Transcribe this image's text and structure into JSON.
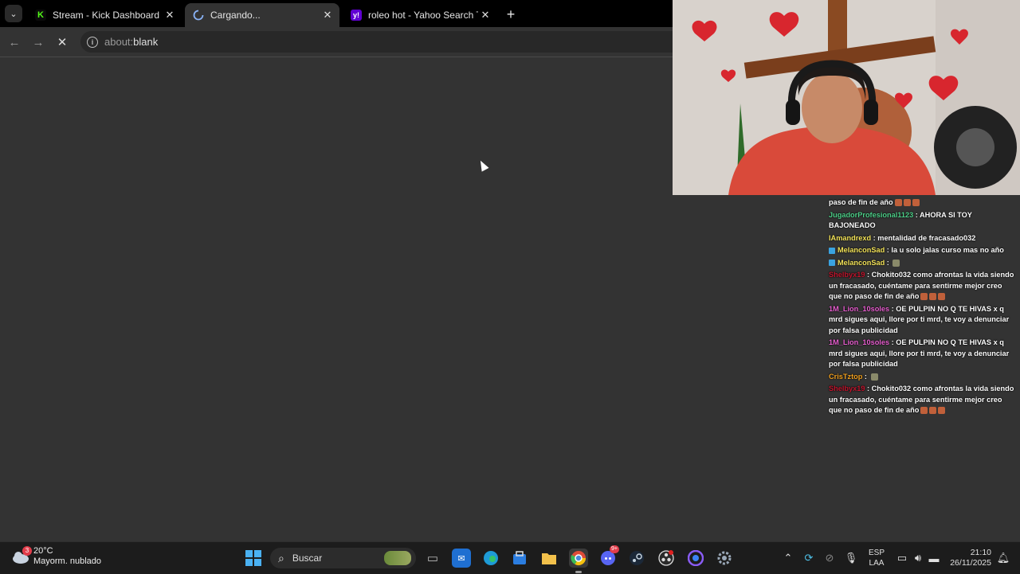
{
  "browser": {
    "tabs": [
      {
        "title": "Stream - Kick Dashboard",
        "favicon": "kick-logo-icon",
        "active": false
      },
      {
        "title": "Cargando...",
        "favicon": "loading-spinner-icon",
        "active": true
      },
      {
        "title": "roleo hot - Yahoo Search Tus re",
        "favicon": "yahoo-logo-icon",
        "active": false
      }
    ],
    "new_tab_symbol": "+",
    "address": {
      "scheme": "about:",
      "path": "blank"
    },
    "colors": {
      "kick": "#53fc18",
      "yahoo": "#6001d2"
    }
  },
  "chat": {
    "messages": [
      {
        "user": "",
        "user_color": "#ffffff",
        "text": "paso de fin de año",
        "emotes": 3
      },
      {
        "user": "JugadorProfesional1123",
        "user_color": "#4fd08a",
        "text": "AHORA SI TOY BAJONEADO",
        "emotes": 0
      },
      {
        "user": "IAmandrexd",
        "user_color": "#f3e35a",
        "text": "mentalidad de fracasado032",
        "emotes": 0
      },
      {
        "user": "MelanconSad",
        "user_color": "#f3e35a",
        "badge": true,
        "text": "la u solo jalas curso mas no año",
        "emotes": 0
      },
      {
        "user": "MelanconSad",
        "user_color": "#f3e35a",
        "badge": true,
        "text": "",
        "emotes": 1
      },
      {
        "user": "Shelbyx19",
        "user_color": "#c0162e",
        "text": "Chokito032 como afrontas la vida siendo un fracasado, cuéntame para sentirme mejor creo que no paso de fin de año",
        "emotes": 3
      },
      {
        "user": "1M_Lion_10soles",
        "user_color": "#e85fd0",
        "text": "OE PULPIN NO Q TE HIVAS x q mrd sigues aqui, llore por ti mrd, te voy a denunciar por falsa publicidad",
        "emotes": 0
      },
      {
        "user": "1M_Lion_10soles",
        "user_color": "#e85fd0",
        "text": "OE PULPIN NO Q TE HIVAS x q mrd sigues aqui, llore por ti mrd, te voy a denunciar por falsa publicidad",
        "emotes": 0
      },
      {
        "user": "CrisTztop",
        "user_color": "#f0a020",
        "text": "",
        "emotes": 1
      },
      {
        "user": "Shelbyx19",
        "user_color": "#c0162e",
        "text": "Chokito032 como afrontas la vida siendo un fracasado, cuéntame para sentirme mejor creo que no paso de fin de año",
        "emotes": 3
      }
    ]
  },
  "taskbar": {
    "weather": {
      "temp": "20°C",
      "desc": "Mayorm. nublado",
      "badge": "3"
    },
    "search_placeholder": "Buscar",
    "apps": [
      "task-view-icon",
      "outlook-icon",
      "edge-icon",
      "store-icon",
      "file-explorer-icon",
      "chrome-icon",
      "discord-icon",
      "steam-icon",
      "obs-icon",
      "app-icon",
      "settings-icon"
    ],
    "discord_badge": "9+",
    "lang": {
      "line1": "ESP",
      "line2": "LAA"
    },
    "clock": {
      "time": "21:10",
      "date": "26/11/2025"
    }
  }
}
